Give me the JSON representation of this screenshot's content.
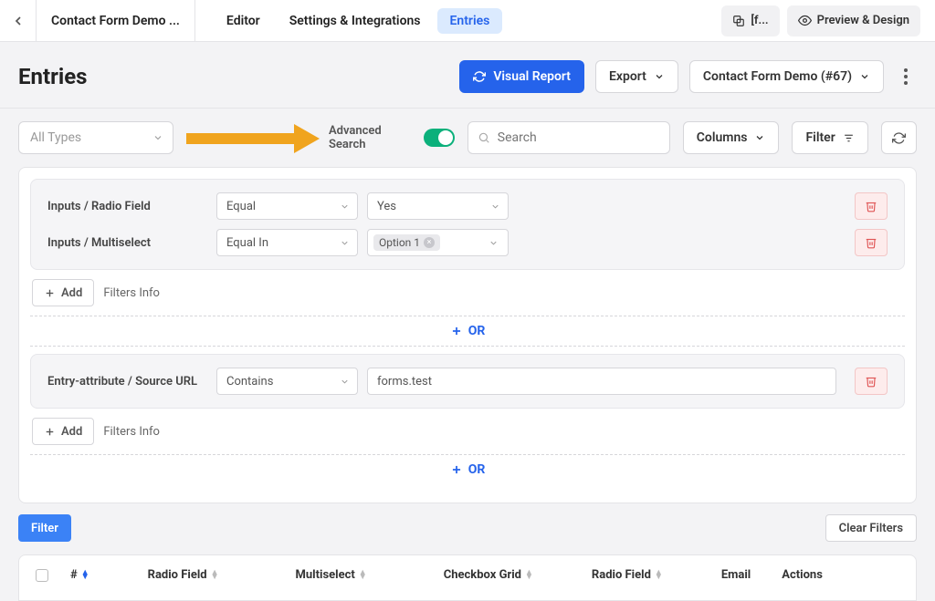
{
  "topbar": {
    "form_title": "Contact Form Demo ...",
    "tabs": {
      "editor": "Editor",
      "settings": "Settings & Integrations",
      "entries": "Entries"
    },
    "shortcode_btn": "[f...",
    "preview_btn": "Preview & Design"
  },
  "header": {
    "title": "Entries",
    "visual_report": "Visual Report",
    "export": "Export",
    "form_selector": "Contact Form Demo (#67)"
  },
  "toolbar": {
    "all_types": "All Types",
    "advanced_search_label": "Advanced Search",
    "search_placeholder": "Search",
    "columns": "Columns",
    "filter": "Filter"
  },
  "adv": {
    "group1": {
      "row1": {
        "label": "Inputs / Radio Field",
        "op": "Equal",
        "val": "Yes"
      },
      "row2": {
        "label": "Inputs / Multiselect",
        "op": "Equal In",
        "tag": "Option 1"
      }
    },
    "group2": {
      "row1": {
        "label": "Entry-attribute / Source URL",
        "op": "Contains",
        "val": "forms.test"
      }
    },
    "add": "Add",
    "filters_info": "Filters Info",
    "or": "OR",
    "filter_btn": "Filter",
    "clear_btn": "Clear Filters"
  },
  "table": {
    "hash": "#",
    "col1": "Radio Field",
    "col2": "Multiselect",
    "col3": "Checkbox Grid",
    "col4": "Radio Field",
    "col5": "Email",
    "actions": "Actions"
  }
}
